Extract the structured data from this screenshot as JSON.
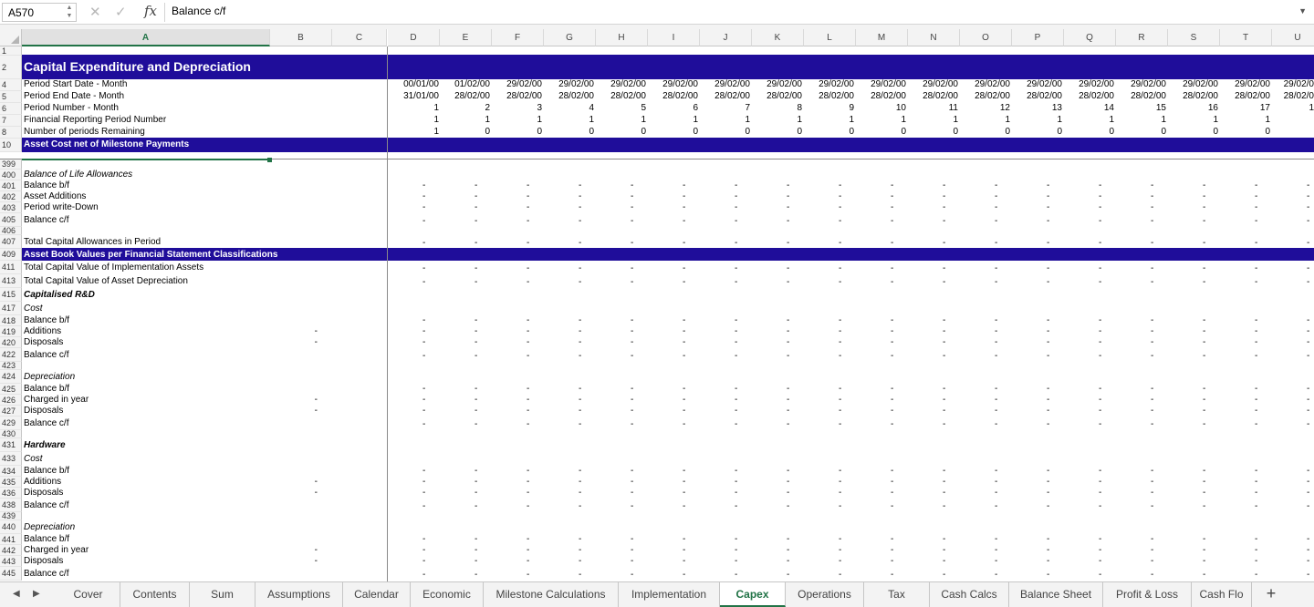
{
  "formula_bar": {
    "name_box": "A570",
    "fx_label": "fx",
    "content": "Balance c/f"
  },
  "columns": [
    "A",
    "B",
    "C",
    "D",
    "E",
    "F",
    "G",
    "H",
    "I",
    "J",
    "K",
    "L",
    "M",
    "N",
    "O",
    "P",
    "Q",
    "R",
    "S",
    "T",
    "U"
  ],
  "active_column": "A",
  "header_rows": [
    {
      "row": "1",
      "label": ""
    },
    {
      "row": "2",
      "label": "Capital Expenditure and Depreciation",
      "style": "band-title"
    },
    {
      "row": "4",
      "label": "Period Start Date - Month",
      "values": [
        "00/01/00",
        "01/02/00",
        "29/02/00",
        "29/02/00",
        "29/02/00",
        "29/02/00",
        "29/02/00",
        "29/02/00",
        "29/02/00",
        "29/02/00",
        "29/02/00",
        "29/02/00",
        "29/02/00",
        "29/02/00",
        "29/02/00",
        "29/02/00",
        "29/02/00",
        "29/02/0"
      ]
    },
    {
      "row": "5",
      "label": "Period End Date - Month",
      "values": [
        "31/01/00",
        "28/02/00",
        "28/02/00",
        "28/02/00",
        "28/02/00",
        "28/02/00",
        "28/02/00",
        "28/02/00",
        "28/02/00",
        "28/02/00",
        "28/02/00",
        "28/02/00",
        "28/02/00",
        "28/02/00",
        "28/02/00",
        "28/02/00",
        "28/02/00",
        "28/02/0"
      ]
    },
    {
      "row": "6",
      "label": "Period Number - Month",
      "values": [
        "1",
        "2",
        "3",
        "4",
        "5",
        "6",
        "7",
        "8",
        "9",
        "10",
        "11",
        "12",
        "13",
        "14",
        "15",
        "16",
        "17",
        "1"
      ]
    },
    {
      "row": "7",
      "label": "Financial Reporting Period Number",
      "values": [
        "1",
        "1",
        "1",
        "1",
        "1",
        "1",
        "1",
        "1",
        "1",
        "1",
        "1",
        "1",
        "1",
        "1",
        "1",
        "1",
        "1",
        ""
      ]
    },
    {
      "row": "8",
      "label": "Number of periods Remaining",
      "values": [
        "1",
        "0",
        "0",
        "0",
        "0",
        "0",
        "0",
        "0",
        "0",
        "0",
        "0",
        "0",
        "0",
        "0",
        "0",
        "0",
        "0",
        ""
      ]
    },
    {
      "row": "10",
      "label": "Asset Cost net of Milestone Payments",
      "style": "band"
    }
  ],
  "body_rows": [
    {
      "row": "399",
      "label": ""
    },
    {
      "row": "400",
      "label": "Balance of Life Allowances",
      "style": "italic"
    },
    {
      "row": "401",
      "label": "Balance b/f",
      "dashes": true
    },
    {
      "row": "402",
      "label": "Asset Additions",
      "dashes": true
    },
    {
      "row": "403",
      "label": "Period write-Down",
      "dashes": true
    },
    {
      "row": "405",
      "label": "Balance c/f",
      "dashes": true
    },
    {
      "row": "406",
      "label": ""
    },
    {
      "row": "407",
      "label": "Total Capital Allowances in Period",
      "dashes": true
    },
    {
      "row": "409",
      "label": "Asset Book Values per Financial Statement Classifications",
      "style": "band"
    },
    {
      "row": "411",
      "label": "Total Capital Value of Implementation Assets",
      "dashes": true
    },
    {
      "row": "413",
      "label": "Total Capital Value of Asset Depreciation",
      "dashes": true
    },
    {
      "row": "415",
      "label": "Capitalised R&D",
      "style": "bolditalic"
    },
    {
      "row": "417",
      "label": "Cost",
      "style": "italic"
    },
    {
      "row": "418",
      "label": "Balance b/f",
      "dashes": true
    },
    {
      "row": "419",
      "label": "Additions",
      "b": "-",
      "dashes": true
    },
    {
      "row": "420",
      "label": "Disposals",
      "b": "-",
      "dashes": true
    },
    {
      "row": "422",
      "label": "Balance c/f",
      "dashes": true
    },
    {
      "row": "423",
      "label": ""
    },
    {
      "row": "424",
      "label": "Depreciation",
      "style": "italic"
    },
    {
      "row": "425",
      "label": "Balance b/f",
      "dashes": true
    },
    {
      "row": "426",
      "label": "Charged in year",
      "b": "-",
      "dashes": true
    },
    {
      "row": "427",
      "label": "Disposals",
      "b": "-",
      "dashes": true
    },
    {
      "row": "429",
      "label": "Balance c/f",
      "dashes": true
    },
    {
      "row": "430",
      "label": ""
    },
    {
      "row": "431",
      "label": "Hardware",
      "style": "bolditalic"
    },
    {
      "row": "433",
      "label": "Cost",
      "style": "italic"
    },
    {
      "row": "434",
      "label": "Balance b/f",
      "dashes": true
    },
    {
      "row": "435",
      "label": "Additions",
      "b": "-",
      "dashes": true
    },
    {
      "row": "436",
      "label": "Disposals",
      "b": "-",
      "dashes": true
    },
    {
      "row": "438",
      "label": "Balance c/f",
      "dashes": true
    },
    {
      "row": "439",
      "label": ""
    },
    {
      "row": "440",
      "label": "Depreciation",
      "style": "italic"
    },
    {
      "row": "441",
      "label": "Balance b/f",
      "dashes": true
    },
    {
      "row": "442",
      "label": "Charged in year",
      "b": "-",
      "dashes": true
    },
    {
      "row": "443",
      "label": "Disposals",
      "b": "-",
      "dashes": true
    },
    {
      "row": "445",
      "label": "Balance c/f",
      "dashes": true
    }
  ],
  "dash_value": "-",
  "sheet_tabs": [
    "Cover",
    "Contents",
    "Sum",
    "Assumptions",
    "Calendar",
    "Economic",
    "Milestone Calculations",
    "Implementation",
    "Capex",
    "Operations",
    "Tax",
    "Cash Calcs",
    "Balance Sheet",
    "Profit & Loss",
    "Cash Flo"
  ],
  "active_tab": "Capex",
  "add_sheet_label": "+",
  "colors": {
    "band": "#1f0d9a",
    "accent": "#217346"
  }
}
